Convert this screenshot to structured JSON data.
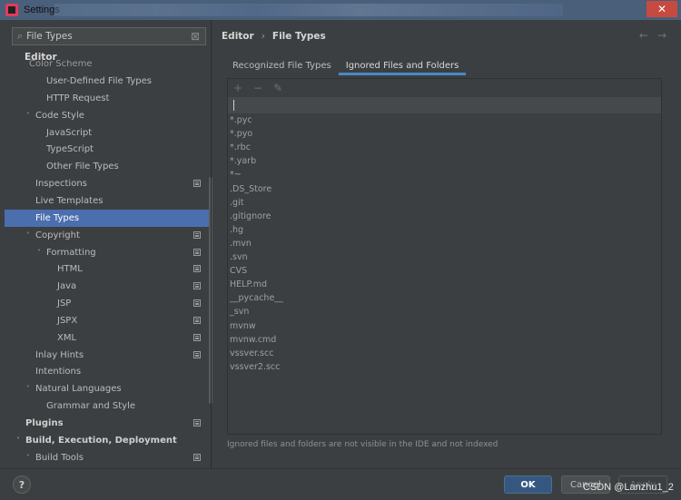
{
  "window": {
    "title": "Settings",
    "close_glyph": "✕"
  },
  "search": {
    "value": "File Types",
    "clear_glyph": "⊠",
    "icon": "search-icon"
  },
  "tree": {
    "header": "Editor",
    "cut_item": "Color Scheme",
    "items": [
      {
        "label": "User-Defined File Types",
        "level": 2,
        "chevron": "",
        "project_icon": false
      },
      {
        "label": "HTTP Request",
        "level": 2,
        "chevron": "",
        "project_icon": false
      },
      {
        "label": "Code Style",
        "level": 1,
        "chevron": "˅",
        "project_icon": false
      },
      {
        "label": "JavaScript",
        "level": 2,
        "chevron": "",
        "project_icon": false
      },
      {
        "label": "TypeScript",
        "level": 2,
        "chevron": "",
        "project_icon": false
      },
      {
        "label": "Other File Types",
        "level": 2,
        "chevron": "",
        "project_icon": false
      },
      {
        "label": "Inspections",
        "level": 1,
        "chevron": "",
        "project_icon": true
      },
      {
        "label": "Live Templates",
        "level": 1,
        "chevron": "",
        "project_icon": false
      },
      {
        "label": "File Types",
        "level": 1,
        "chevron": "",
        "project_icon": false,
        "selected": true
      },
      {
        "label": "Copyright",
        "level": 1,
        "chevron": "˅",
        "project_icon": true
      },
      {
        "label": "Formatting",
        "level": 2,
        "chevron": "˅",
        "project_icon": true
      },
      {
        "label": "HTML",
        "level": 3,
        "chevron": "",
        "project_icon": true
      },
      {
        "label": "Java",
        "level": 3,
        "chevron": "",
        "project_icon": true
      },
      {
        "label": "JSP",
        "level": 3,
        "chevron": "",
        "project_icon": true
      },
      {
        "label": "JSPX",
        "level": 3,
        "chevron": "",
        "project_icon": true
      },
      {
        "label": "XML",
        "level": 3,
        "chevron": "",
        "project_icon": true
      },
      {
        "label": "Inlay Hints",
        "level": 1,
        "chevron": "",
        "project_icon": true
      },
      {
        "label": "Intentions",
        "level": 1,
        "chevron": "",
        "project_icon": false
      },
      {
        "label": "Natural Languages",
        "level": 1,
        "chevron": "˅",
        "project_icon": false
      },
      {
        "label": "Grammar and Style",
        "level": 2,
        "chevron": "",
        "project_icon": false
      },
      {
        "label": "Plugins",
        "level": 0,
        "chevron": "",
        "project_icon": true,
        "bold": true
      },
      {
        "label": "Build, Execution, Deployment",
        "level": 0,
        "chevron": "˅",
        "project_icon": false,
        "bold": true
      },
      {
        "label": "Build Tools",
        "level": 1,
        "chevron": "˅",
        "project_icon": true
      }
    ]
  },
  "breadcrumb": {
    "first": "Editor",
    "separator": "›",
    "second": "File Types"
  },
  "nav": {
    "back": "←",
    "forward": "→"
  },
  "tabs": [
    {
      "label": "Recognized File Types",
      "active": false
    },
    {
      "label": "Ignored Files and Folders",
      "active": true
    }
  ],
  "list_tools": {
    "add": "+",
    "remove": "−",
    "edit": "✎"
  },
  "ignored_items": [
    "*.pyc",
    "*.pyo",
    "*.rbc",
    "*.yarb",
    "*~",
    ".DS_Store",
    ".git",
    ".gitignore",
    ".hg",
    ".mvn",
    ".svn",
    "CVS",
    "HELP.md",
    "__pycache__",
    "_svn",
    "mvnw",
    "mvnw.cmd",
    "vssver.scc",
    "vssver2.scc"
  ],
  "hint": "Ignored files and folders are not visible in the IDE and not indexed",
  "buttons": {
    "help": "?",
    "ok": "OK",
    "cancel": "Cancel",
    "apply": "Apply"
  },
  "watermark": "CSDN @Lanzhu1_2",
  "colors": {
    "selection": "#4b6eaf",
    "accent_tab": "#4a88c7",
    "ok_button": "#365880",
    "title_bar": "#4a5f7a"
  }
}
